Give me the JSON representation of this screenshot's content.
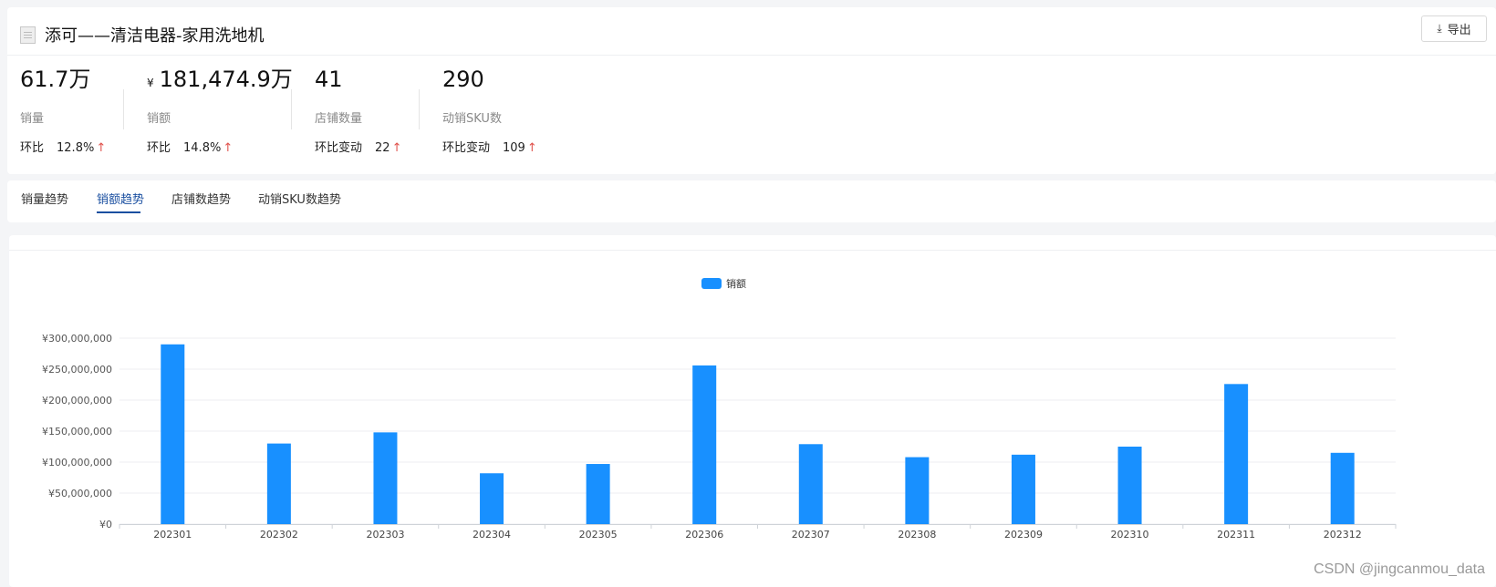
{
  "header": {
    "title": "添可——清洁电器-家用洗地机",
    "export_label": "导出",
    "export_icon": "download-icon"
  },
  "metrics": [
    {
      "value": "61.7万",
      "label": "销量",
      "change_label": "环比",
      "change_value": "12.8%",
      "direction": "up"
    },
    {
      "value": "181,474.9万",
      "currency": "¥",
      "label": "销额",
      "change_label": "环比",
      "change_value": "14.8%",
      "direction": "up"
    },
    {
      "value": "41",
      "label": "店铺数量",
      "change_label": "环比变动",
      "change_value": "22",
      "direction": "up"
    },
    {
      "value": "290",
      "label": "动销SKU数",
      "change_label": "环比变动",
      "change_value": "109",
      "direction": "up"
    }
  ],
  "tabs": [
    {
      "label": "销量趋势",
      "active": false
    },
    {
      "label": "销额趋势",
      "active": true
    },
    {
      "label": "店铺数趋势",
      "active": false
    },
    {
      "label": "动销SKU数趋势",
      "active": false
    }
  ],
  "colors": {
    "bar": "#1890ff",
    "active_tab": "#1a4fa0",
    "up_arrow": "#e0514b"
  },
  "chart_data": {
    "type": "bar",
    "title": "",
    "xlabel": "",
    "ylabel": "",
    "legend_position": "top-center",
    "grid": true,
    "categories": [
      "202301",
      "202302",
      "202303",
      "202304",
      "202305",
      "202306",
      "202307",
      "202308",
      "202309",
      "202310",
      "202311",
      "202312"
    ],
    "series": [
      {
        "name": "销额",
        "values": [
          290000000,
          130000000,
          148000000,
          82000000,
          97000000,
          256000000,
          129000000,
          108000000,
          112000000,
          125000000,
          226000000,
          115000000
        ]
      }
    ],
    "ylim": [
      0,
      300000000
    ],
    "yticks": [
      0,
      50000000,
      100000000,
      150000000,
      200000000,
      250000000,
      300000000
    ],
    "ytick_labels": [
      "¥0",
      "¥50,000,000",
      "¥100,000,000",
      "¥150,000,000",
      "¥200,000,000",
      "¥250,000,000",
      "¥300,000,000"
    ]
  },
  "watermark": "CSDN @jingcanmou_data"
}
